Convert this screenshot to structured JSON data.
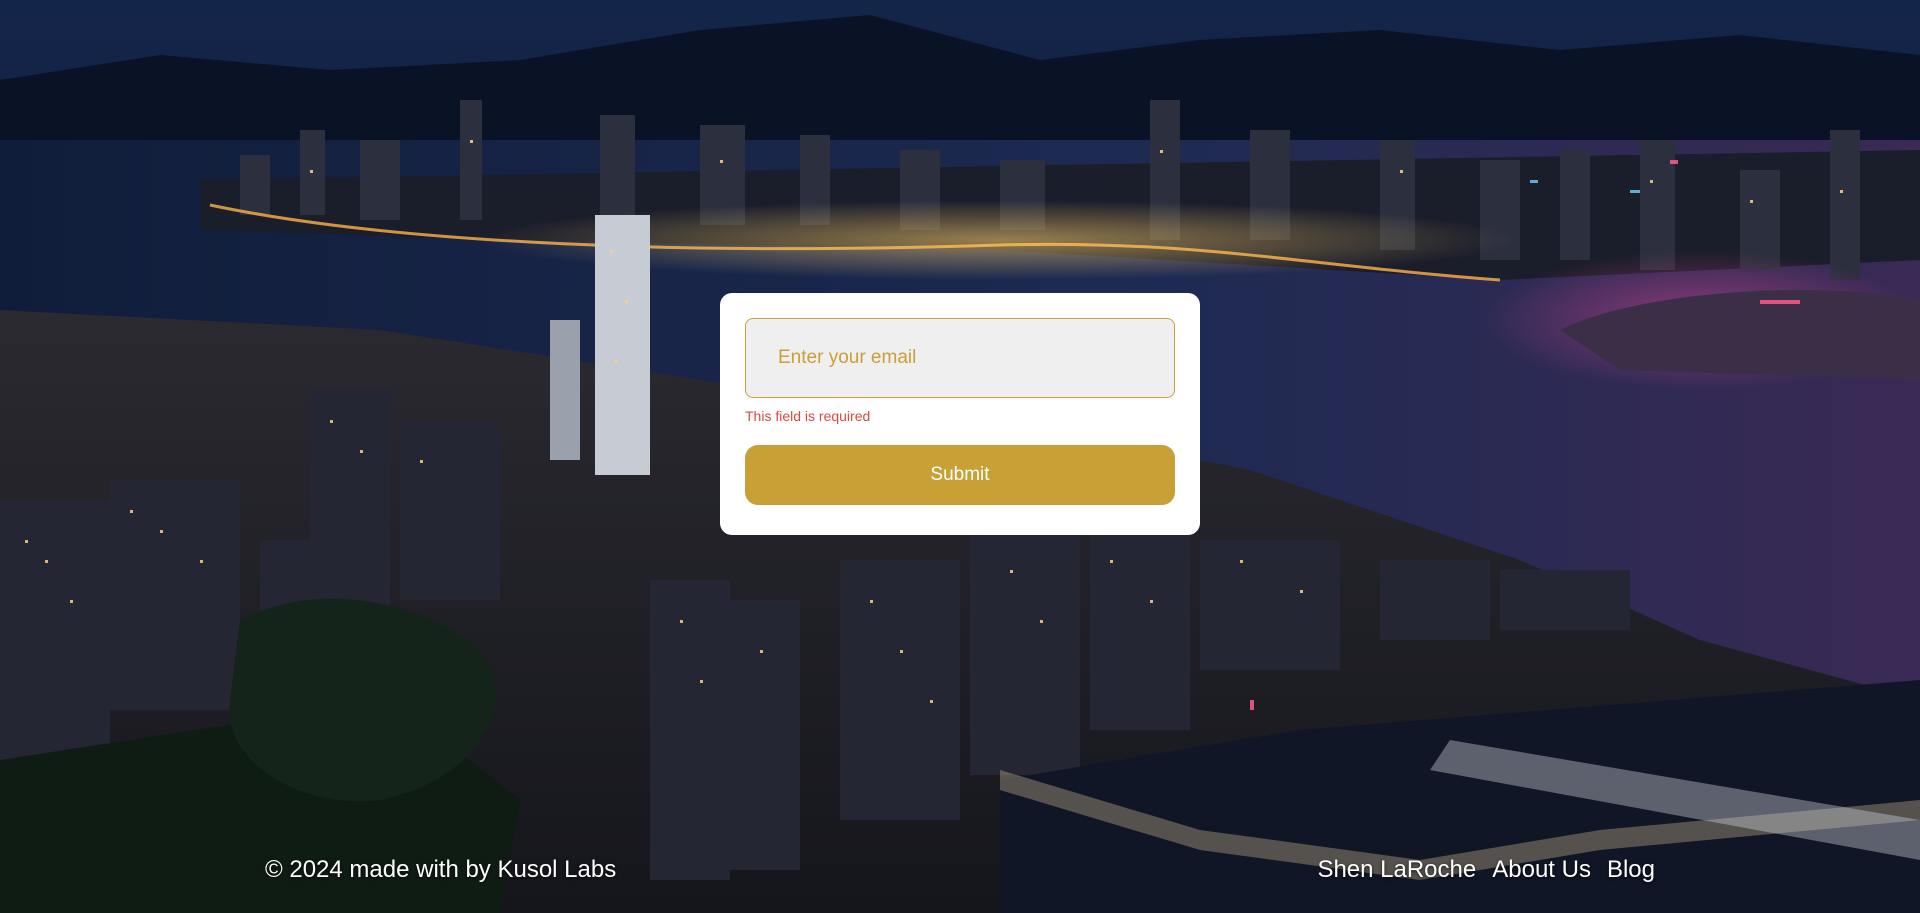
{
  "background": {
    "image": "night-city-harbor-skyline"
  },
  "form": {
    "email_placeholder": "Enter your email",
    "email_value": "",
    "error_message": "This field is required",
    "submit_label": "Submit"
  },
  "footer": {
    "copyright": "© 2024 made with by Kusol Labs",
    "links": [
      {
        "label": "Shen LaRoche"
      },
      {
        "label": "About Us"
      },
      {
        "label": "Blog"
      }
    ]
  },
  "colors": {
    "accent": "#c9a036",
    "error": "#e0463e",
    "card_bg": "#ffffff",
    "input_bg": "#efefef"
  }
}
